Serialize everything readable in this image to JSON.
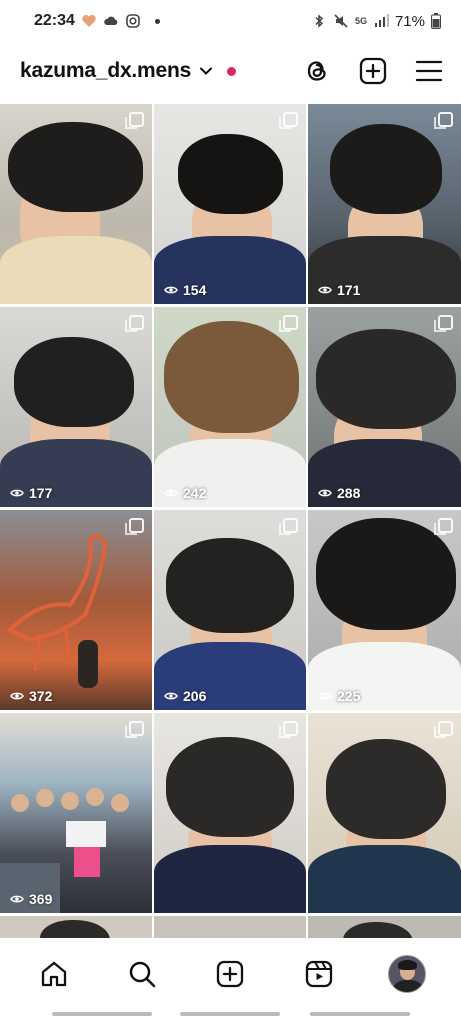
{
  "status_bar": {
    "time": "22:34",
    "battery": "71%",
    "network": "5G"
  },
  "header": {
    "username": "kazuma_dx.mens",
    "icons": [
      "chevron-down-icon",
      "threads-icon",
      "new-post-icon",
      "menu-icon"
    ],
    "live_dot_color": "#e0245e"
  },
  "grid": {
    "tiles": [
      {
        "views": "",
        "multi": true
      },
      {
        "views": "154",
        "multi": true
      },
      {
        "views": "171",
        "multi": true
      },
      {
        "views": "177",
        "multi": true
      },
      {
        "views": "242",
        "multi": true
      },
      {
        "views": "288",
        "multi": true
      },
      {
        "views": "372",
        "multi": true
      },
      {
        "views": "206",
        "multi": true
      },
      {
        "views": "225",
        "multi": true
      },
      {
        "views": "369",
        "multi": true
      },
      {
        "views": "",
        "multi": true
      },
      {
        "views": "",
        "multi": true
      }
    ]
  },
  "bottom_nav": {
    "items": [
      "home-icon",
      "search-icon",
      "create-icon",
      "reels-icon",
      "profile-avatar"
    ]
  }
}
